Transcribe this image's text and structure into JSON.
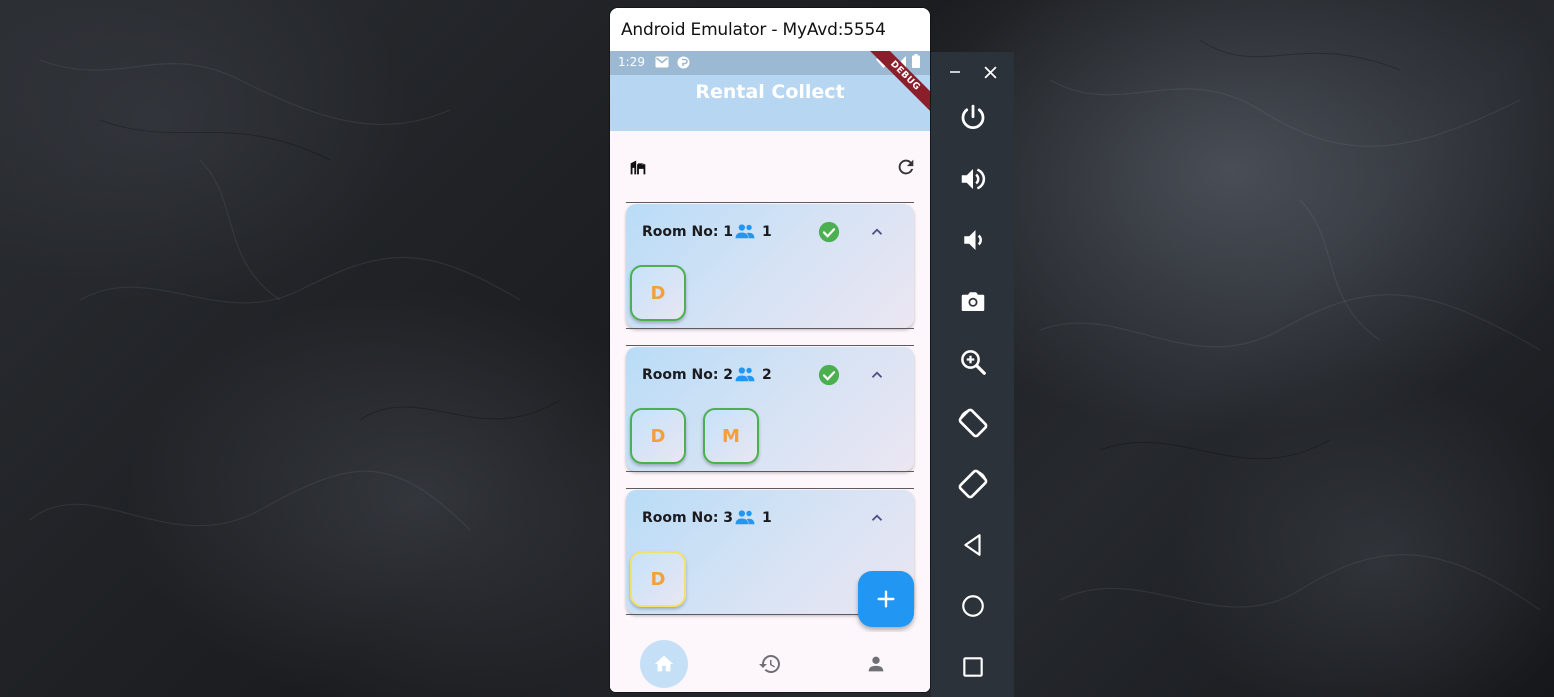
{
  "window": {
    "title": "Android Emulator - MyAvd:5554"
  },
  "status_bar": {
    "time": "1:29"
  },
  "app": {
    "title": "Rental Collect",
    "debug_banner": "DEBUG"
  },
  "rooms": [
    {
      "label": "Room No: 1",
      "tenant_count": "1",
      "paid": true,
      "tenants": [
        {
          "initial": "D",
          "status": "paid"
        }
      ]
    },
    {
      "label": "Room No: 2",
      "tenant_count": "2",
      "paid": true,
      "tenants": [
        {
          "initial": "D",
          "status": "paid"
        },
        {
          "initial": "M",
          "status": "paid"
        }
      ]
    },
    {
      "label": "Room No: 3",
      "tenant_count": "1",
      "paid": false,
      "tenants": [
        {
          "initial": "D",
          "status": "pending"
        }
      ]
    }
  ],
  "icons": {
    "toolbar": [
      "buildings-icon",
      "refresh-icon"
    ],
    "room": [
      "people-icon",
      "check-circle-icon",
      "chevron-up-icon"
    ],
    "fab": "plus-icon",
    "bottom_nav": [
      "home-icon",
      "history-icon",
      "person-icon"
    ],
    "emulator_panel": [
      "minimize-icon",
      "close-icon",
      "power-icon",
      "volume-up-icon",
      "volume-down-icon",
      "camera-icon",
      "zoom-icon",
      "rotate-left-icon",
      "rotate-right-icon",
      "back-icon",
      "home-circle-icon",
      "overview-icon"
    ]
  },
  "colors": {
    "app_bar": "#b6d6f1",
    "status_bar": "#9cb9d3",
    "accent": "#2196f3",
    "paid": "#4caf50",
    "pending_border": "#f3e26a",
    "initial_text": "#f2a03d",
    "emulator_panel": "#2b323a"
  },
  "bottom_nav": {
    "active": "home"
  }
}
